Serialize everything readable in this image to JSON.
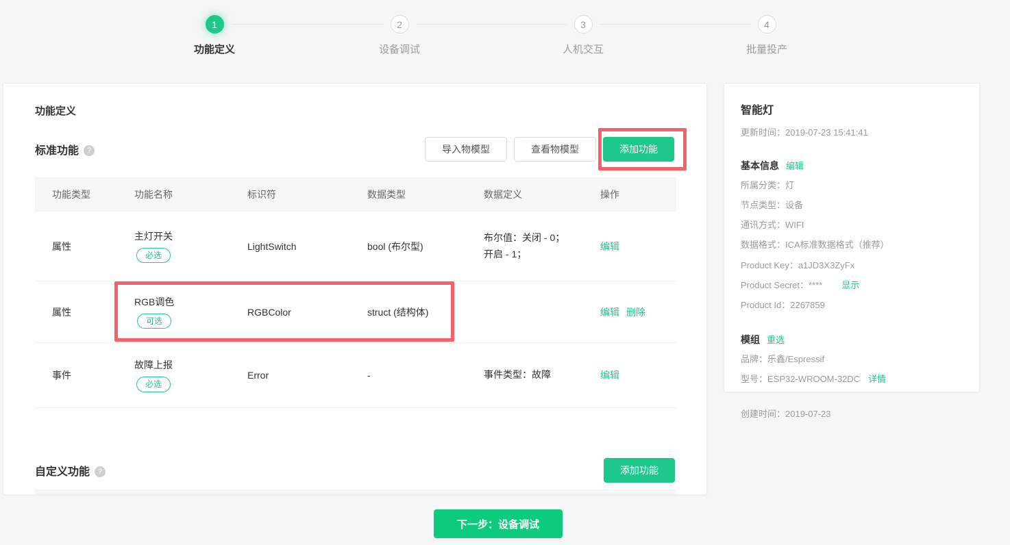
{
  "colors": {
    "accent": "#1ec88b",
    "cta_green": "#0ccb7d",
    "highlight_red": "#f4606c"
  },
  "icons": {
    "help": "?"
  },
  "stepper": {
    "steps": [
      {
        "number": "1",
        "label": "功能定义",
        "state": "active"
      },
      {
        "number": "2",
        "label": "设备调试",
        "state": "inactive"
      },
      {
        "number": "3",
        "label": "人机交互",
        "state": "inactive"
      },
      {
        "number": "4",
        "label": "批量投产",
        "state": "inactive"
      }
    ]
  },
  "main": {
    "title": "功能定义",
    "standard": {
      "title": "标准功能",
      "import_button": "导入物模型",
      "view_button": "查看物模型",
      "add_button": "添加功能",
      "table": {
        "headers": [
          "功能类型",
          "功能名称",
          "标识符",
          "数据类型",
          "数据定义",
          "操作"
        ],
        "rows": [
          {
            "type": "属性",
            "name": "主灯开关",
            "badge": "必选",
            "identifier": "LightSwitch",
            "data_type": "bool (布尔型)",
            "definition": "布尔值：关闭 - 0；开启 - 1；",
            "action_edit": "编辑"
          },
          {
            "type": "属性",
            "name": "RGB调色",
            "badge": "可选",
            "identifier": "RGBColor",
            "data_type": "struct (结构体)",
            "definition": "",
            "action_edit": "编辑",
            "action_delete": "删除",
            "highlighted": true
          },
          {
            "type": "事件",
            "name": "故障上报",
            "badge": "必选",
            "identifier": "Error",
            "data_type": "-",
            "definition": "事件类型：故障",
            "action_edit": "编辑"
          }
        ]
      }
    },
    "custom": {
      "title": "自定义功能",
      "add_button": "添加功能"
    }
  },
  "sidebar": {
    "product_name": "智能灯",
    "updated_time": "更新时间：2019-07-23 15:41:41",
    "basic_info_title": "基本信息",
    "basic_info_edit": "编辑",
    "info_rows": {
      "category": "所属分类：灯",
      "node_type": "节点类型：设备",
      "comm": "通讯方式：WIFI",
      "data_format": "数据格式：ICA标准数据格式（推荐）",
      "product_key": "Product Key：a1JD3X3ZyFx",
      "product_secret": "Product Secret：****",
      "secret_show": "显示",
      "product_id": "Product Id：2267859"
    },
    "module_title": "模组",
    "module_reselect": "重选",
    "module_brand": "品牌：乐鑫/Espressif",
    "module_model": "型号：ESP32-WROOM-32DC",
    "module_detail": "详情",
    "created_time": "创建时间：2019-07-23"
  },
  "footer": {
    "next_button": "下一步：设备调试"
  }
}
